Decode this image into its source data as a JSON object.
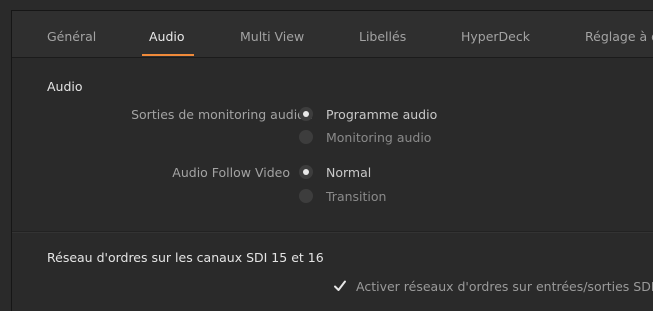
{
  "tabs": [
    {
      "label": "Général",
      "active": false
    },
    {
      "label": "Audio",
      "active": true
    },
    {
      "label": "Multi View",
      "active": false
    },
    {
      "label": "Libellés",
      "active": false
    },
    {
      "label": "HyperDeck",
      "active": false
    },
    {
      "label": "Réglage à d",
      "active": false
    }
  ],
  "audio_section": {
    "title": "Audio",
    "monitoring_label": "Sorties de monitoring audio :",
    "monitoring_options": [
      {
        "label": "Programme audio",
        "selected": true
      },
      {
        "label": "Monitoring audio",
        "selected": false
      }
    ],
    "follow_label": "Audio Follow Video",
    "follow_options": [
      {
        "label": "Normal",
        "selected": true
      },
      {
        "label": "Transition",
        "selected": false
      }
    ]
  },
  "talkback_section": {
    "title": "Réseau d'ordres sur les canaux SDI 15 et 16",
    "checkbox_label": "Activer réseaux d'ordres sur entrées/sorties SDI",
    "checked": true
  },
  "colors": {
    "accent": "#f08a3a",
    "background": "#2a2a2a"
  }
}
